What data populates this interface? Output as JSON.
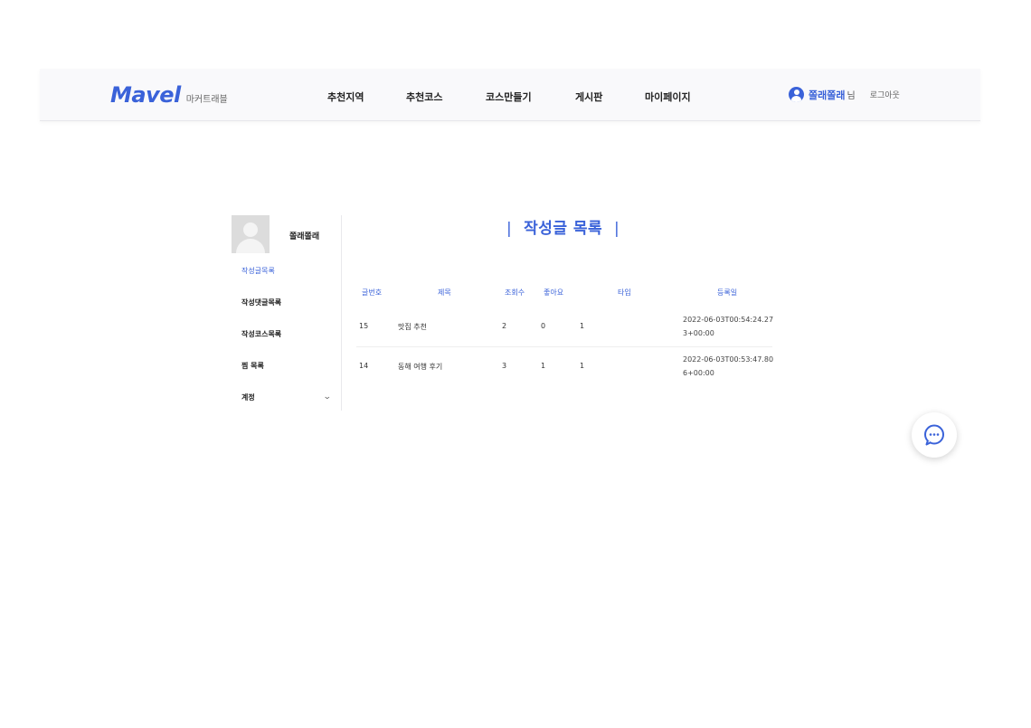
{
  "header": {
    "logo_text": "Mavel",
    "logo_sub": "마커트래블",
    "nav": [
      "추천지역",
      "추천코스",
      "코스만들기",
      "게시판",
      "마이페이지"
    ],
    "user_name": "쫄래쫄래",
    "user_suffix": "님",
    "logout_label": "로그아웃"
  },
  "sidebar": {
    "profile_name": "쫄래쫄래",
    "items": [
      {
        "label": "작성글목록",
        "active": true
      },
      {
        "label": "작성댓글목록",
        "active": false
      },
      {
        "label": "작성코스목록",
        "active": false
      },
      {
        "label": "찜 목록",
        "active": false
      },
      {
        "label": "계정",
        "active": false
      }
    ]
  },
  "main": {
    "title": "작성글 목록",
    "columns": [
      "글번호",
      "제목",
      "조회수",
      "좋아요",
      "타입",
      "등록일"
    ],
    "rows": [
      {
        "no": "15",
        "title": "맛집 추천",
        "views": "2",
        "likes": "0",
        "type": "1",
        "date": "2022-06-03T00:54:24.273+00:00"
      },
      {
        "no": "14",
        "title": "동해 여행 후기",
        "views": "3",
        "likes": "1",
        "type": "1",
        "date": "2022-06-03T00:53:47.806+00:00"
      }
    ]
  },
  "colors": {
    "accent": "#3a62d9"
  },
  "icons": {
    "user": "user-circle-icon",
    "chat": "chat-bubble-icon",
    "chevron": "chevron-down-icon"
  }
}
